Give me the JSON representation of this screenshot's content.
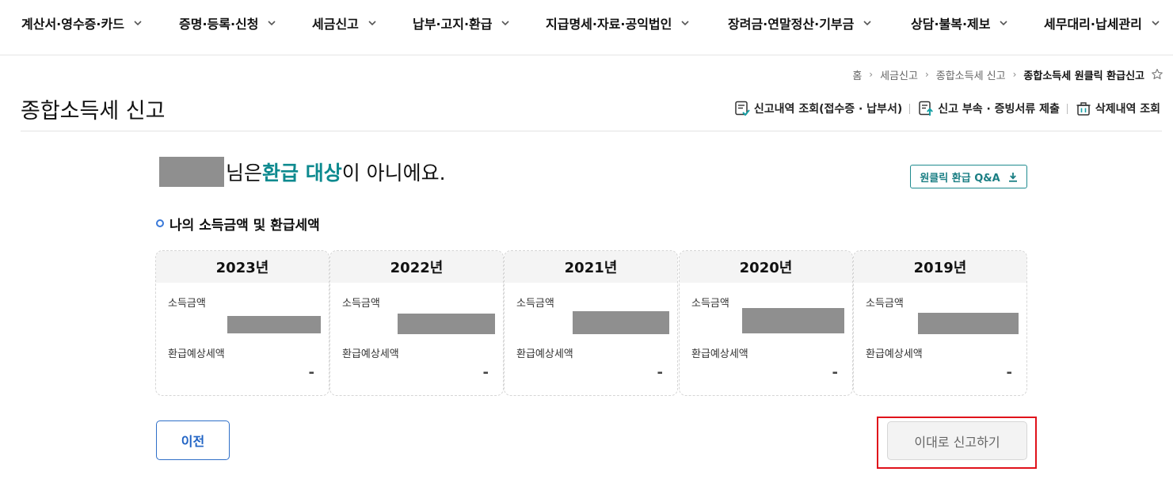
{
  "nav": {
    "items": [
      {
        "label": "계산서·영수증·카드"
      },
      {
        "label": "증명·등록·신청"
      },
      {
        "label": "세금신고"
      },
      {
        "label": "납부·고지·환급"
      },
      {
        "label": "지급명세·자료·공익법인"
      },
      {
        "label": "장려금·연말정산·기부금"
      },
      {
        "label": "상담·불복·제보"
      },
      {
        "label": "세무대리·납세관리"
      }
    ]
  },
  "breadcrumb": {
    "home": "홈",
    "level1": "세금신고",
    "level2": "종합소득세 신고",
    "current": "종합소득세 원클릭 환급신고"
  },
  "page": {
    "title": "종합소득세 신고"
  },
  "header_links": {
    "history": "신고내역 조회(접수증 · 납부서)",
    "attach": "신고 부속 · 증빙서류 제출",
    "deleted": "삭제내역 조회"
  },
  "result": {
    "suffix_nim": "님은 ",
    "highlight": "환급 대상",
    "suffix_end": "이 아니에요.",
    "qa_button": "원클릭 환급 Q&A"
  },
  "section": {
    "title": "나의 소득금액 및 환급세액"
  },
  "cards": [
    {
      "year": "2023년",
      "income_label": "소득금액",
      "refund_label": "환급예상세액",
      "refund_value": "-"
    },
    {
      "year": "2022년",
      "income_label": "소득금액",
      "refund_label": "환급예상세액",
      "refund_value": "-"
    },
    {
      "year": "2021년",
      "income_label": "소득금액",
      "refund_label": "환급예상세액",
      "refund_value": "-"
    },
    {
      "year": "2020년",
      "income_label": "소득금액",
      "refund_label": "환급예상세액",
      "refund_value": "-"
    },
    {
      "year": "2019년",
      "income_label": "소득금액",
      "refund_label": "환급예상세액",
      "refund_value": "-"
    }
  ],
  "buttons": {
    "prev": "이전",
    "submit": "이대로 신고하기"
  },
  "colors": {
    "highlight_teal": "#0e8a8f",
    "primary_blue": "#2063c4",
    "annotation_red": "#e0121b"
  }
}
